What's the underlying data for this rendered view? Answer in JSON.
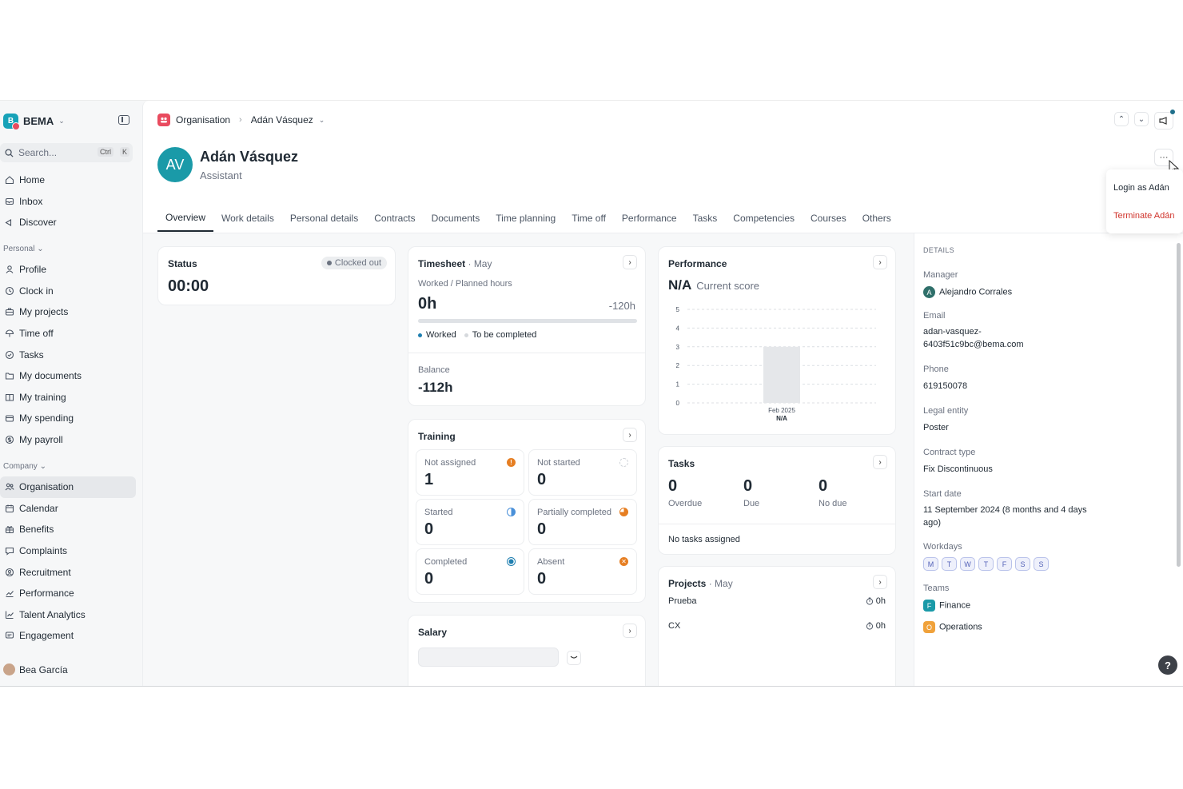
{
  "sidebar": {
    "brand": "BEMA",
    "search_placeholder": "Search...",
    "search_kbd": [
      "Ctrl",
      "K"
    ],
    "main_items": [
      {
        "label": "Home",
        "icon": "home-icon"
      },
      {
        "label": "Inbox",
        "icon": "inbox-icon"
      },
      {
        "label": "Discover",
        "icon": "discover-icon"
      }
    ],
    "personal_label": "Personal",
    "personal_items": [
      {
        "label": "Profile",
        "icon": "user-icon"
      },
      {
        "label": "Clock in",
        "icon": "clock-icon"
      },
      {
        "label": "My projects",
        "icon": "briefcase-icon"
      },
      {
        "label": "Time off",
        "icon": "umbrella-icon"
      },
      {
        "label": "Tasks",
        "icon": "check-circle-icon"
      },
      {
        "label": "My documents",
        "icon": "folder-icon"
      },
      {
        "label": "My training",
        "icon": "book-icon"
      },
      {
        "label": "My spending",
        "icon": "wallet-icon"
      },
      {
        "label": "My payroll",
        "icon": "payroll-icon"
      }
    ],
    "company_label": "Company",
    "company_items": [
      {
        "label": "Organisation",
        "icon": "people-icon",
        "active": true
      },
      {
        "label": "Calendar",
        "icon": "calendar-icon"
      },
      {
        "label": "Benefits",
        "icon": "gift-icon"
      },
      {
        "label": "Complaints",
        "icon": "chat-icon"
      },
      {
        "label": "Recruitment",
        "icon": "search-person-icon"
      },
      {
        "label": "Performance",
        "icon": "trend-icon"
      },
      {
        "label": "Talent Analytics",
        "icon": "chart-icon"
      },
      {
        "label": "Engagement",
        "icon": "message-icon"
      }
    ],
    "user": "Bea García"
  },
  "header": {
    "breadcrumb_root": "Organisation",
    "breadcrumb_current": "Adán Vásquez",
    "name": "Adán Vásquez",
    "role": "Assistant",
    "initials": "AV"
  },
  "menu": {
    "login_as": "Login as Adán",
    "terminate": "Terminate Adán"
  },
  "tabs": [
    "Overview",
    "Work details",
    "Personal details",
    "Contracts",
    "Documents",
    "Time planning",
    "Time off",
    "Performance",
    "Tasks",
    "Competencies",
    "Courses",
    "Others"
  ],
  "status": {
    "title": "Status",
    "badge": "Clocked out",
    "time": "00:00"
  },
  "timesheet": {
    "title": "Timesheet",
    "month": "· May",
    "subtitle": "Worked / Planned hours",
    "worked": "0h",
    "diff": "-120h",
    "legend_worked": "Worked",
    "legend_todo": "To be completed",
    "balance_label": "Balance",
    "balance": "-112h"
  },
  "training": {
    "title": "Training",
    "items": [
      {
        "label": "Not assigned",
        "value": "1",
        "color": "#e67e22"
      },
      {
        "label": "Not started",
        "value": "0",
        "color": "#cfd3d8"
      },
      {
        "label": "Started",
        "value": "0",
        "color": "#4a90d9"
      },
      {
        "label": "Partially completed",
        "value": "0",
        "color": "#e67e22"
      },
      {
        "label": "Completed",
        "value": "0",
        "color": "#1f7fb0"
      },
      {
        "label": "Absent",
        "value": "0",
        "color": "#e67e22"
      }
    ]
  },
  "salary": {
    "title": "Salary"
  },
  "performance": {
    "title": "Performance",
    "score": "N/A",
    "score_label": "Current score"
  },
  "chart_data": {
    "type": "bar",
    "categories": [
      "Feb 2025"
    ],
    "category_sub": [
      "N/A"
    ],
    "values": [
      3
    ],
    "yticks": [
      "5",
      "4",
      "3",
      "2",
      "1",
      "0"
    ],
    "ylim": [
      0,
      5
    ]
  },
  "tasks": {
    "title": "Tasks",
    "counts": [
      {
        "value": "0",
        "label": "Overdue"
      },
      {
        "value": "0",
        "label": "Due"
      },
      {
        "value": "0",
        "label": "No due"
      }
    ],
    "empty": "No tasks assigned"
  },
  "projects": {
    "title": "Projects",
    "month": "· May",
    "items": [
      {
        "name": "Prueba",
        "hours": "0h"
      },
      {
        "name": "CX",
        "hours": "0h"
      }
    ]
  },
  "details": {
    "heading": "DETAILS",
    "manager_label": "Manager",
    "manager": "Alejandro Corrales",
    "manager_initial": "A",
    "email_label": "Email",
    "email_line1": "adan-vasquez-",
    "email_line2": "6403f51c9bc@bema.com",
    "phone_label": "Phone",
    "phone": "619150078",
    "legal_label": "Legal entity",
    "legal": "Poster",
    "contract_label": "Contract type",
    "contract": "Fix Discontinuous",
    "start_label": "Start date",
    "start_line1": "11 September 2024 (8 months and 4 days",
    "start_line2": "ago)",
    "workdays_label": "Workdays",
    "workdays": [
      "M",
      "T",
      "W",
      "T",
      "F",
      "S",
      "S"
    ],
    "teams_label": "Teams",
    "teams": [
      {
        "initial": "F",
        "name": "Finance",
        "color": "#1a9aa8"
      },
      {
        "initial": "O",
        "name": "Operations",
        "color": "#f0a23b"
      }
    ]
  },
  "help": "?"
}
